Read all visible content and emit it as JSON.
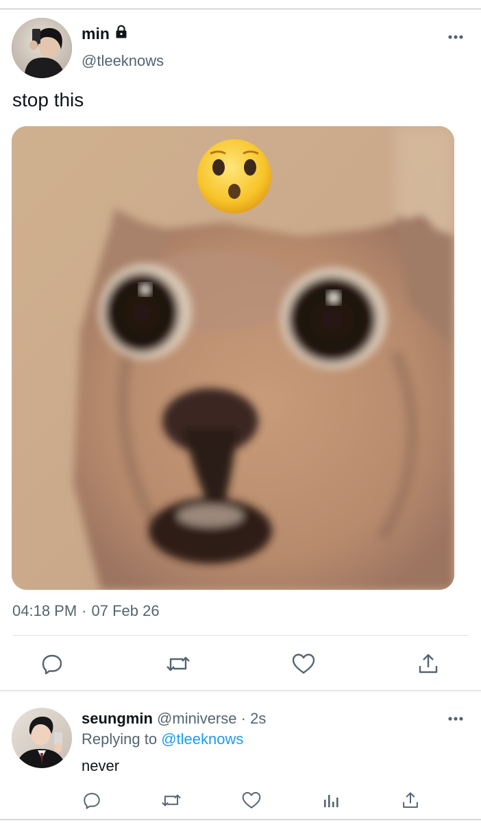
{
  "tweet": {
    "display_name": "min",
    "handle": "@tleeknows",
    "protected": true,
    "text": "stop this",
    "time": "04:18 PM",
    "separator": "·",
    "date": "07 Feb 26",
    "media": {
      "kind": "photo",
      "subject": "blurry surprised cat with shocked face emoji"
    },
    "actions": [
      "reply-icon",
      "retweet-icon",
      "like-icon",
      "share-icon"
    ],
    "more_icon": "more-dots-icon"
  },
  "reply": {
    "display_name": "seungmin",
    "handle": "@miniverse",
    "separator": "·",
    "time": "2s",
    "replying_prefix": "Replying to",
    "replying_to": "@tleeknows",
    "text": "never",
    "actions": [
      "reply-icon",
      "retweet-icon",
      "like-icon",
      "views-icon",
      "share-icon"
    ],
    "more_icon": "more-dots-icon"
  },
  "colors": {
    "text": "#0f1419",
    "secondary": "#536471",
    "link": "#1d9bf0",
    "divider": "#dde1e4"
  }
}
